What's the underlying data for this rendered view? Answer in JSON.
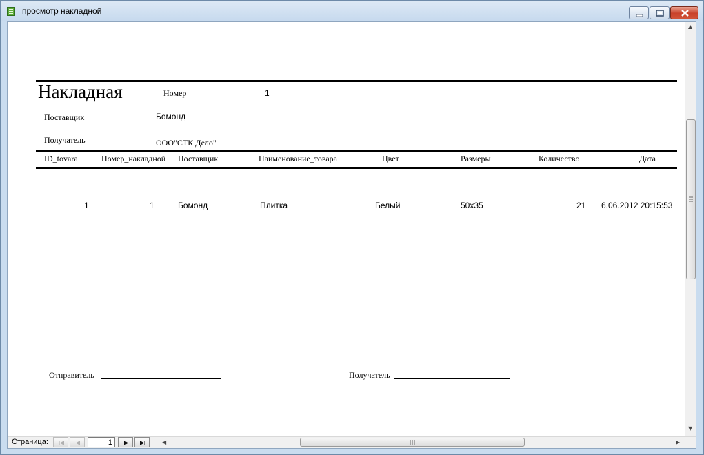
{
  "window": {
    "title": "просмотр накладной"
  },
  "report": {
    "title": "Накладная",
    "number_label": "Номер",
    "number_value": "1",
    "supplier_label": "Поставщик",
    "supplier_value": "Бомонд",
    "recipient_label": "Получатель",
    "recipient_value": "ООО\"СТК Дело\"",
    "columns": [
      "ID_tovara",
      "Номер_накладной",
      "Поставщик",
      "Наименование_товара",
      "Цвет",
      "Размеры",
      "Количество",
      "Дата"
    ],
    "rows": [
      [
        "1",
        "1",
        "Бомонд",
        "Плитка",
        "Белый",
        "50x35",
        "21",
        "6.06.2012 20:15:53"
      ]
    ],
    "footer": {
      "sender_label": "Отправитель",
      "recipient_label": "Получатель"
    }
  },
  "navigation": {
    "page_label": "Страница:",
    "page_value": "1"
  }
}
